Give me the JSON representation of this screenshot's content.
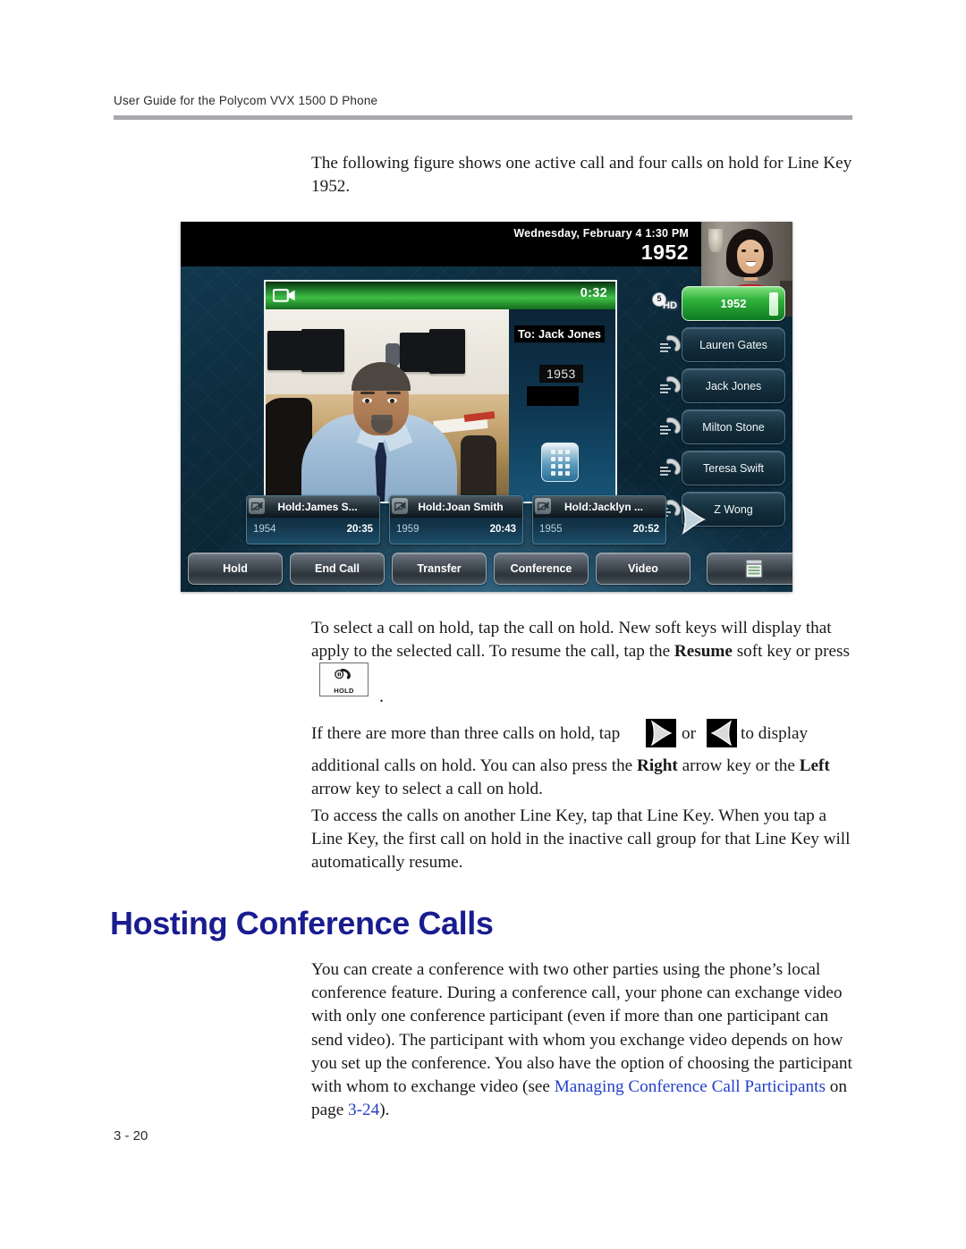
{
  "document": {
    "running_header": "User Guide for the Polycom VVX 1500 D Phone",
    "footer_page": "3 - 20"
  },
  "paragraphs": {
    "intro": "The following figure shows one active call and four calls on hold for Line Key 1952.",
    "select_hold_1": "To select a call on hold, tap the call on hold. New soft keys will display that apply to the selected call. To resume the call, tap the ",
    "select_hold_resume_bold": "Resume",
    "select_hold_2": " soft key or press",
    "hold_period": ".",
    "more_calls_1": "If there are more than three calls on hold, tap",
    "more_calls_or": "or",
    "more_calls_2": "to display",
    "more_calls_3": "additional calls on hold. You can also press the ",
    "more_calls_right_bold": "Right",
    "more_calls_4": " arrow key or the",
    "more_calls_left_bold": "Left",
    "more_calls_5": " arrow key to select a call on hold.",
    "another_linekey": "To access the calls on another Line Key, tap that Line Key. When you tap a Line Key, the first call on hold in the inactive call group for that Line Key will automatically resume."
  },
  "section": {
    "heading": "Hosting Conference Calls",
    "body_1": "You can create a conference with two other parties using the phone’s local conference feature. During a conference call, your phone can exchange video with only one conference participant (even if more than one participant can send video). The participant with whom you exchange video depends on how you set up the conference. You also have the option of choosing the participant with whom to exchange video (see ",
    "link_text": "Managing Conference Call Participants",
    "body_2": " on page ",
    "link_page": "3-24",
    "body_3": ")."
  },
  "phone": {
    "status_bar": {
      "datetime": "Wednesday, February 4  1:30 PM",
      "extension": "1952"
    },
    "active_call": {
      "duration": "0:32",
      "to_label": "To: Jack Jones",
      "number": "1953",
      "camera_icon": "video-camera-icon",
      "dialpad_icon": "dialpad-icon"
    },
    "hd_badge": {
      "count": "5",
      "label": "HD"
    },
    "line_keys": [
      {
        "label": "1952",
        "active": true
      },
      {
        "label": "Lauren Gates",
        "active": false
      },
      {
        "label": "Jack Jones",
        "active": false
      },
      {
        "label": "Milton Stone",
        "active": false
      },
      {
        "label": "Teresa Swift",
        "active": false
      },
      {
        "label": "Z Wong",
        "active": false
      }
    ],
    "calls_on_hold": [
      {
        "name": "Hold:James S...",
        "extension": "1954",
        "time": "20:35"
      },
      {
        "name": "Hold:Joan Smith",
        "extension": "1959",
        "time": "20:43"
      },
      {
        "name": "Hold:Jacklyn ...",
        "extension": "1955",
        "time": "20:52"
      }
    ],
    "soft_keys": [
      {
        "label": "Hold"
      },
      {
        "label": "End Call"
      },
      {
        "label": "Transfer"
      },
      {
        "label": "Conference"
      },
      {
        "label": "Video"
      }
    ],
    "menu_soft_key_icon": "menu-list-icon"
  },
  "key_icons": {
    "hold_key_label": "HOLD",
    "right_arrow": "right-arrow-icon",
    "left_arrow": "left-arrow-icon"
  },
  "colors": {
    "heading": "#1a1d8f",
    "link": "#2340c8",
    "header_rule": "#a7a9ac",
    "active_linekey": "#2fb13a"
  }
}
